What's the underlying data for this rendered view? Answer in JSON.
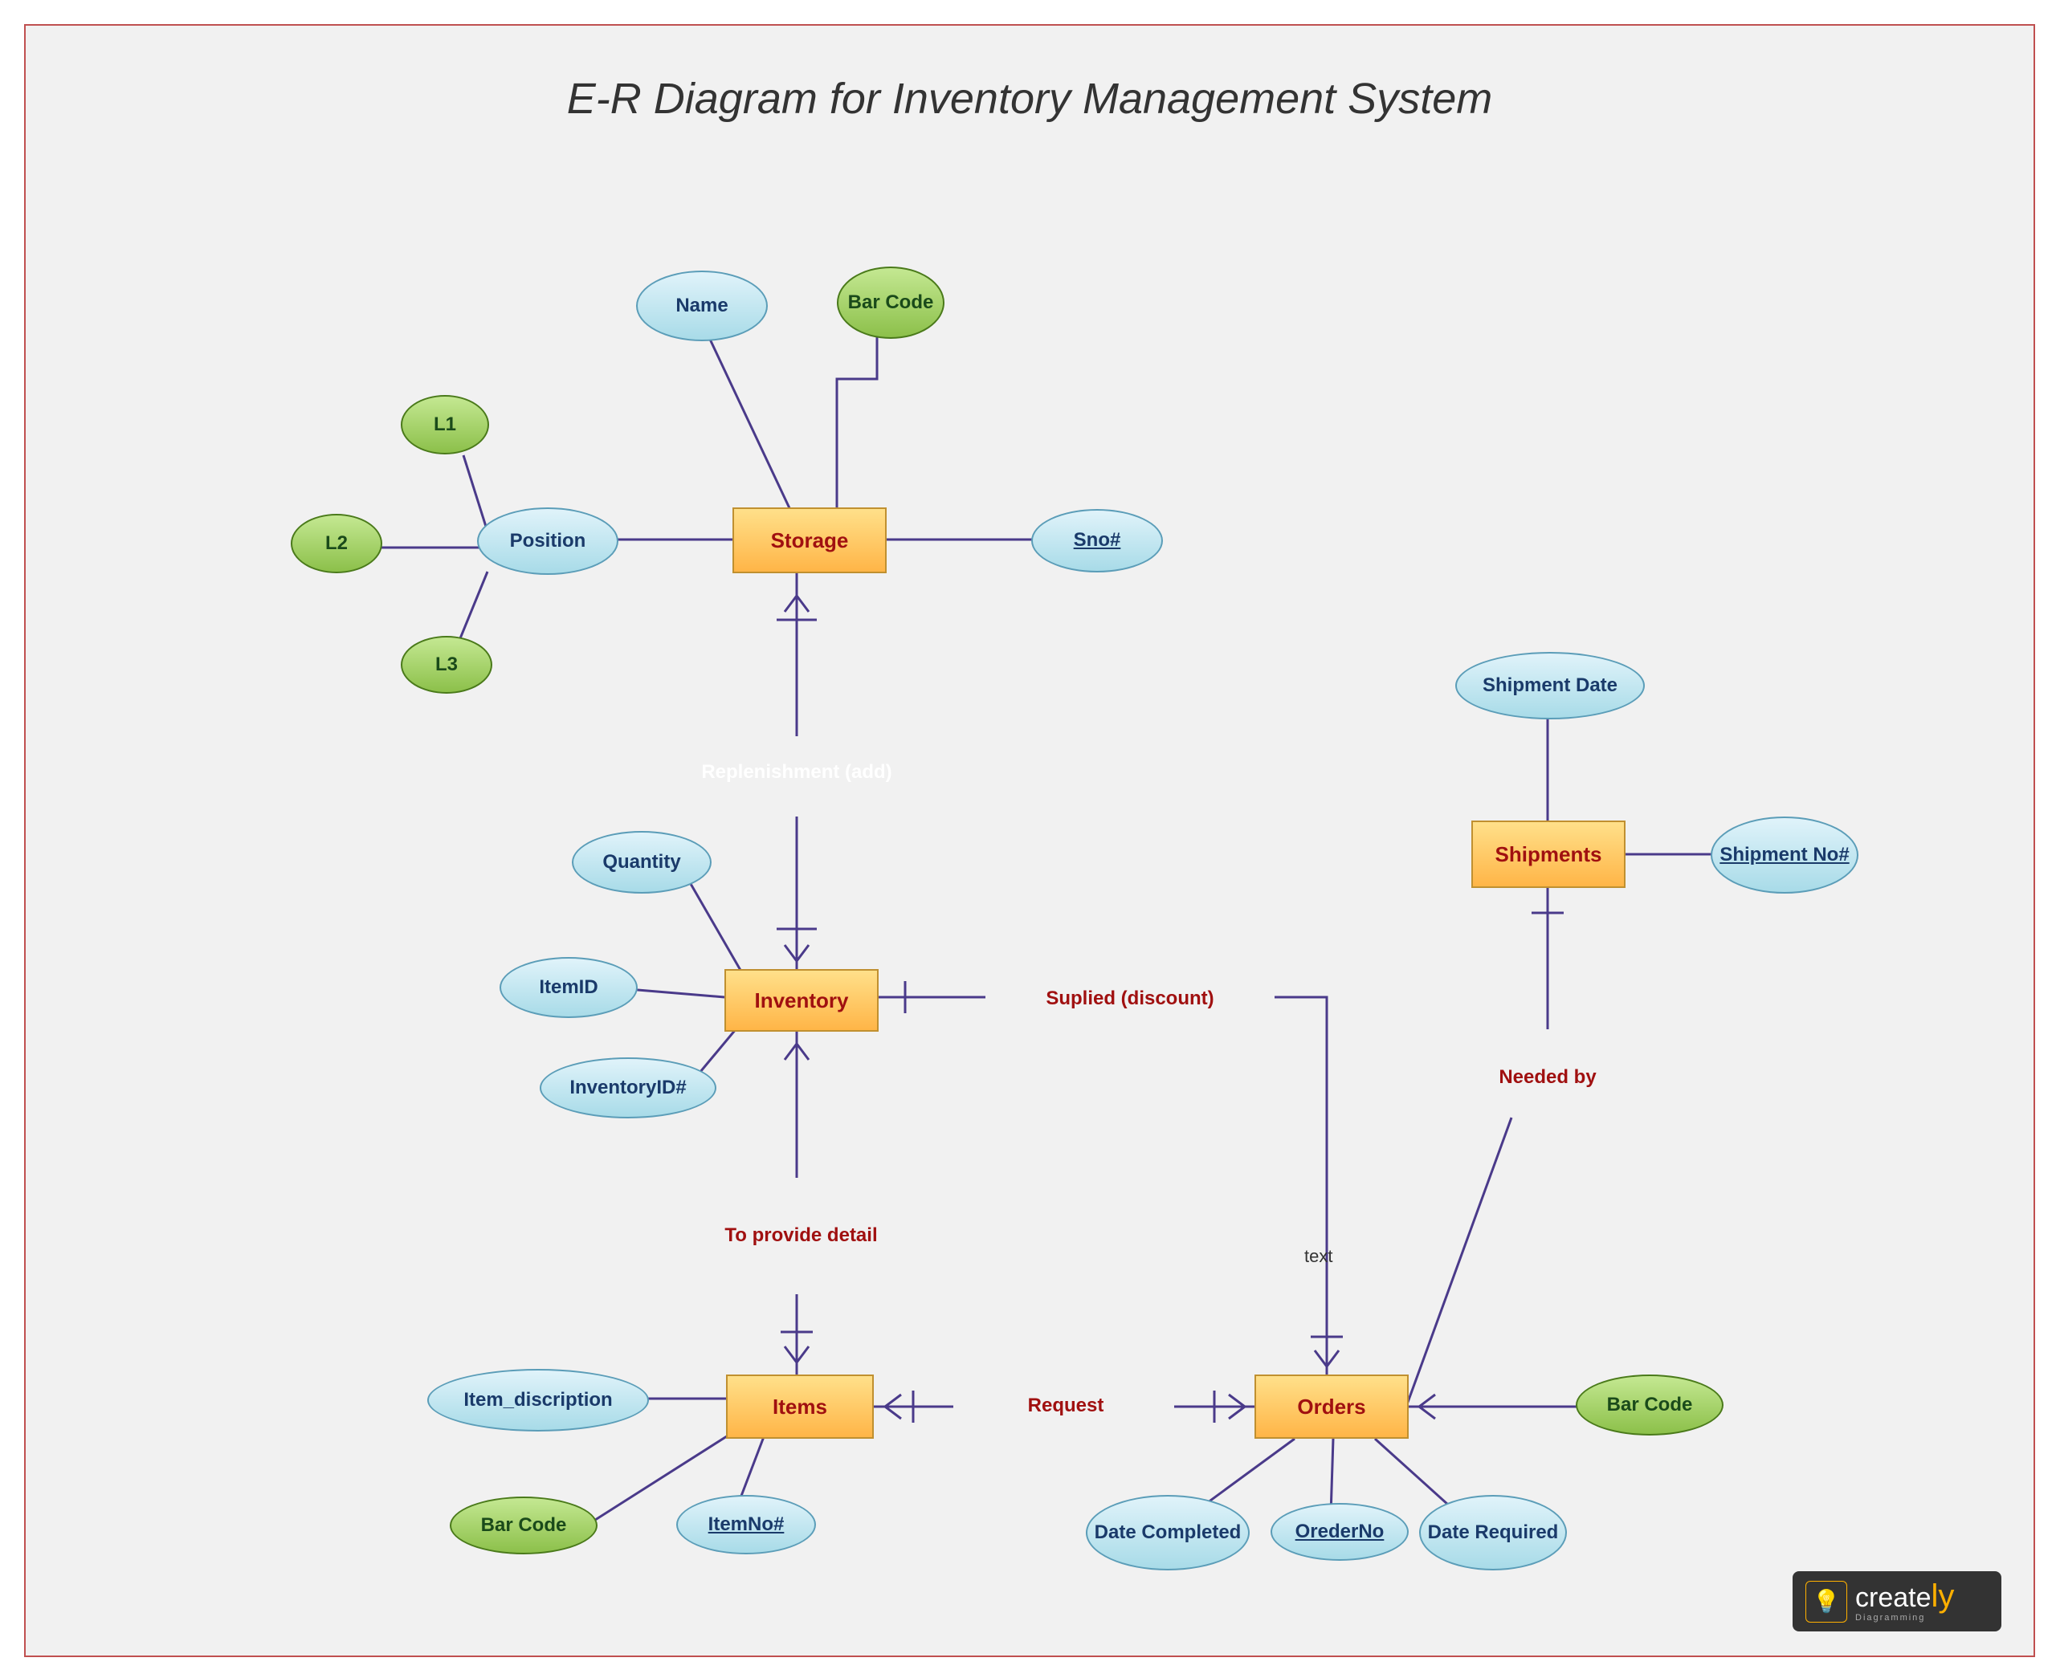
{
  "title": "E-R Diagram for Inventory Management System",
  "entities": {
    "storage": "Storage",
    "inventory": "Inventory",
    "items": "Items",
    "orders": "Orders",
    "shipments": "Shipments"
  },
  "attributes": {
    "name": "Name",
    "barcode_storage": "Bar Code",
    "sno": "Sno#",
    "position": "Position",
    "l1": "L1",
    "l2": "L2",
    "l3": "L3",
    "quantity": "Quantity",
    "itemid": "ItemID",
    "inventoryid": "InventoryID#",
    "item_description": "Item_discription",
    "itemno": "ItemNo#",
    "barcode_items": "Bar Code",
    "date_completed": "Date Completed",
    "orderno": "OrederNo",
    "date_required": "Date Required",
    "barcode_orders": "Bar Code",
    "shipment_date": "Shipment Date",
    "shipment_no": "Shipment No#"
  },
  "relations": {
    "replenishment": "Replenishment (add)",
    "supplied": "Suplied (discount)",
    "to_provide_detail": "To provide detail",
    "request": "Request",
    "needed_by": "Needed by"
  },
  "labels": {
    "text": "text"
  },
  "logo": {
    "brand": "create",
    "suffix": "ly",
    "sub": "Diagramming"
  }
}
